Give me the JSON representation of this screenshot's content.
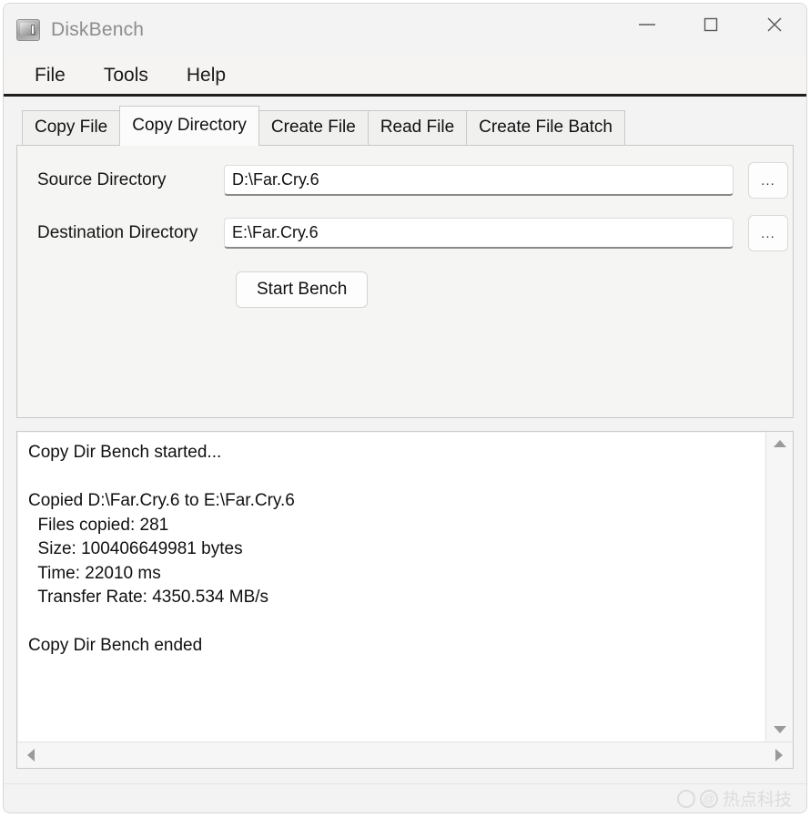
{
  "window": {
    "title": "DiskBench",
    "icon": "disk-drive-icon",
    "controls": {
      "minimize": "minimize-icon",
      "maximize": "maximize-icon",
      "close": "close-icon"
    }
  },
  "menubar": {
    "items": [
      {
        "label": "File"
      },
      {
        "label": "Tools"
      },
      {
        "label": "Help"
      }
    ]
  },
  "tabs": [
    {
      "label": "Copy File",
      "active": false
    },
    {
      "label": "Copy Directory",
      "active": true
    },
    {
      "label": "Create File",
      "active": false
    },
    {
      "label": "Read File",
      "active": false
    },
    {
      "label": "Create File Batch",
      "active": false
    }
  ],
  "form": {
    "source": {
      "label": "Source Directory",
      "value": "D:\\Far.Cry.6",
      "placeholder": "",
      "browse_label": "..."
    },
    "destination": {
      "label": "Destination Directory",
      "value": "E:\\Far.Cry.6",
      "placeholder": "",
      "browse_label": "..."
    },
    "start_button": "Start Bench"
  },
  "log": {
    "lines": [
      "Copy Dir Bench started...",
      "",
      "Copied D:\\Far.Cry.6 to E:\\Far.Cry.6",
      "  Files copied: 281",
      "  Size: 100406649981 bytes",
      "  Time: 22010 ms",
      "  Transfer Rate: 4350.534 MB/s",
      "",
      "Copy Dir Bench ended"
    ],
    "text": "Copy Dir Bench started...\n\nCopied D:\\Far.Cry.6 to E:\\Far.Cry.6\n  Files copied: 281\n  Size: 100406649981 bytes\n  Time: 22010 ms\n  Transfer Rate: 4350.534 MB/s\n\nCopy Dir Bench ended",
    "results": {
      "files_copied": 281,
      "size_bytes": 100406649981,
      "time_ms": 22010,
      "transfer_rate_mb_s": 4350.534,
      "source": "D:\\Far.Cry.6",
      "destination": "E:\\Far.Cry.6"
    },
    "scrollbars": {
      "up_arrow": "scroll-up-icon",
      "down_arrow": "scroll-down-icon",
      "left_arrow": "scroll-left-icon",
      "right_arrow": "scroll-right-icon"
    }
  },
  "watermark": {
    "text": "热点科技",
    "at": "@"
  },
  "colors": {
    "window_bg": "#f3f3f3",
    "panel_bg": "#f5f5f4",
    "log_bg": "#ffffff",
    "menu_rule": "#1d1d1d",
    "border": "#c9c9c9",
    "text": "#101010",
    "title_text": "#8d8d8d",
    "field_underline": "#8a8a8a",
    "scroll_arrow": "#9a9a9a",
    "watermark": "#dcdcdc"
  }
}
